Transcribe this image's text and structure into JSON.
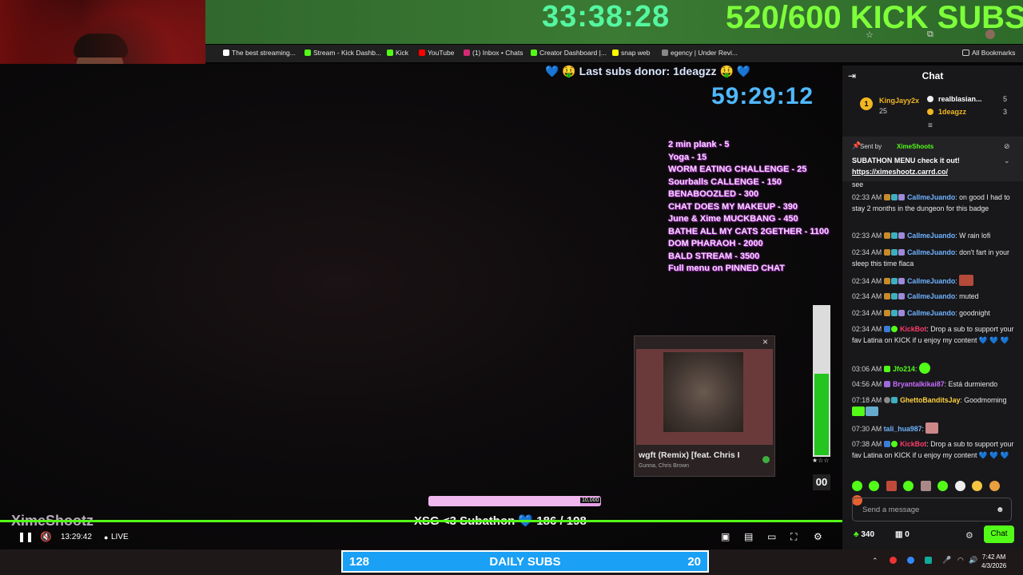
{
  "overlay": {
    "timer_big": "33:38:28",
    "kick_subs": "520/600 KICK SUBS",
    "last_subs_donor": "💙 🤑 Last subs donor: 1deagzz 🤑 💙",
    "countdown": "59:29:12",
    "menu": [
      "2 min plank - 5",
      "Yoga - 15",
      "WORM EATING CHALLENGE - 25",
      "Sourballs CALLENGE - 150",
      "BENABOOZLED - 300",
      "CHAT DOES MY MAKEUP - 390",
      "June & Xime MUCKBANG - 450",
      "BATHE ALL MY CATS 2GETHER - 1100",
      "DOM PHARAOH - 2000",
      "BALD STREAM - 3500",
      "Full menu on PINNED CHAT"
    ],
    "subathon_line": "XSG <3 Subathon 💙 186 / 198",
    "streamer_logo": "XimeShootz",
    "progress_label": "10,000",
    "progress_fraction": 0.88,
    "meter_count": "00",
    "meter_fraction": 0.55,
    "meter_stars": "★☆☆"
  },
  "music": {
    "title": "wgft (Remix) [feat. Chris I",
    "artist": "Gunna, Chris Brown",
    "close": "×"
  },
  "bookmarks": [
    {
      "label": "The best streaming...",
      "color": "#ffffff"
    },
    {
      "label": "Stream - Kick Dashb...",
      "color": "#53fc18"
    },
    {
      "label": "Kick",
      "color": "#53fc18"
    },
    {
      "label": "YouTube",
      "color": "#ff0000"
    },
    {
      "label": "(1) Inbox • Chats",
      "color": "#d62976"
    },
    {
      "label": "Creator Dashboard |...",
      "color": "#53fc18"
    },
    {
      "label": "snap web",
      "color": "#fffc00"
    },
    {
      "label": "egency | Under Revi...",
      "color": "#888888"
    },
    {
      "label": "All Bookmarks",
      "color": "#cccccc"
    }
  ],
  "player": {
    "time": "13:29:42",
    "live": "LIVE"
  },
  "daily": {
    "left": "128",
    "label": "DAILY SUBS",
    "right": "20"
  },
  "clock": {
    "time": "7:42 AM",
    "date": "4/3/2026"
  },
  "chat": {
    "title": "Chat",
    "leaders": [
      {
        "name": "KingJayy2x",
        "count": "25"
      },
      {
        "name": "realblasian...",
        "count": "5"
      },
      {
        "name": "1deagzz",
        "count": "3"
      }
    ],
    "pinned_sender_label": "Sent by",
    "pinned_sender": "XimeShoots",
    "pinned_text": "SUBATHON MENU check it out!",
    "pinned_link": "https://ximeshootz.carrd.co/",
    "partial": "see",
    "messages": [
      {
        "time": "02:33 AM",
        "user": "CallmeJuando",
        "color": "#6fb3ff",
        "text": "on good I had to stay 2 months in the dungeon for this badge"
      },
      {
        "time": "02:33 AM",
        "user": "CallmeJuando",
        "color": "#6fb3ff",
        "text": "W rain lofi"
      },
      {
        "time": "02:34 AM",
        "user": "CallmeJuando",
        "color": "#6fb3ff",
        "text": "don't fart in your sleep this time flaca"
      },
      {
        "time": "02:34 AM",
        "user": "CallmeJuando",
        "color": "#6fb3ff",
        "text": ""
      },
      {
        "time": "02:34 AM",
        "user": "CallmeJuando",
        "color": "#6fb3ff",
        "text": "muted"
      },
      {
        "time": "02:34 AM",
        "user": "CallmeJuando",
        "color": "#6fb3ff",
        "text": "goodnight"
      },
      {
        "time": "02:34 AM",
        "user": "KickBot",
        "color": "#ff3b6b",
        "text": "Drop a sub to support your fav Latina on KICK if u enjoy my content 💙 💙 💙"
      },
      {
        "time": "03:06 AM",
        "user": "Jfo214",
        "color": "#53fc18",
        "text": ""
      },
      {
        "time": "04:56 AM",
        "user": "Bryantalkikai87",
        "color": "#c86cff",
        "text": "Está durmiendo"
      },
      {
        "time": "07:18 AM",
        "user": "GhettoBanditsJay",
        "color": "#ffd23f",
        "text": "Goodmorning"
      },
      {
        "time": "07:30 AM",
        "user": "tali_hua987",
        "color": "#6fb3ff",
        "text": ""
      },
      {
        "time": "07:38 AM",
        "user": "KickBot",
        "color": "#ff3b6b",
        "text": "Drop a sub to support your fav Latina on KICK if u enjoy my content 💙 💙 💙"
      }
    ],
    "input_placeholder": "Send a message",
    "points": "340",
    "points_other": "0",
    "chat_button": "Chat"
  }
}
